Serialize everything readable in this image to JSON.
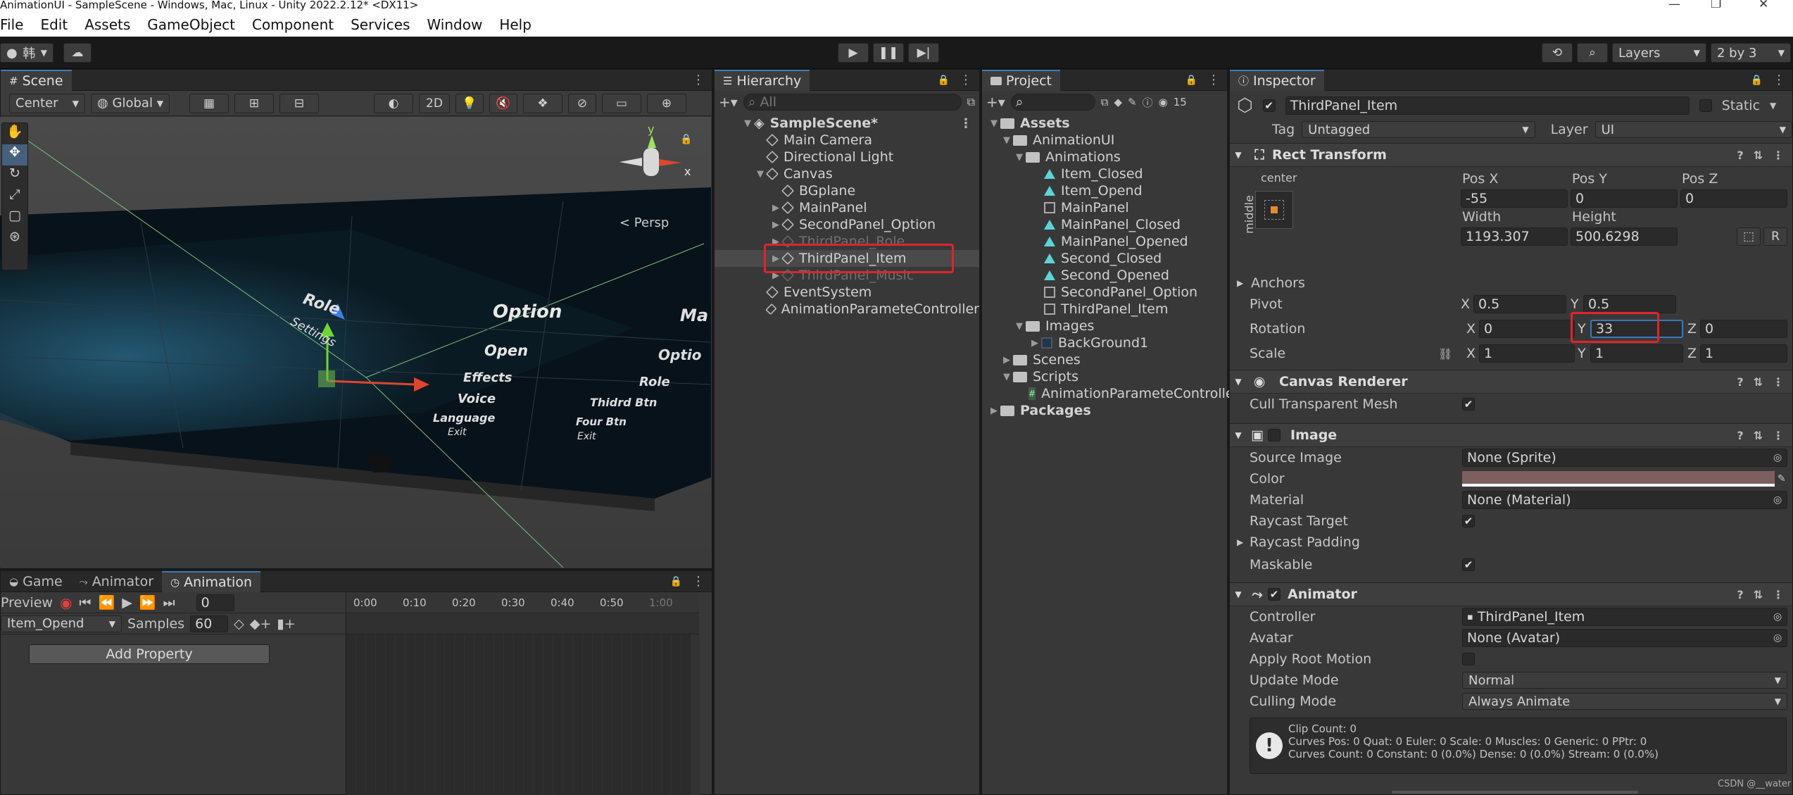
{
  "window": {
    "title": "AnimationUI - SampleScene - Windows, Mac, Linux - Unity 2022.2.12* <DX11>"
  },
  "menu": [
    "File",
    "Edit",
    "Assets",
    "GameObject",
    "Component",
    "Services",
    "Window",
    "Help"
  ],
  "toolbar": {
    "account": "韩",
    "layers": "Layers",
    "layout": "2 by 3"
  },
  "scene": {
    "tab": "Scene",
    "pivot": "Center",
    "space": "Global",
    "mode2d": "2D",
    "persp": "< Persp",
    "gizmo_y": "y",
    "gizmo_x": "x",
    "labels": [
      "Role",
      "Option",
      "Ma",
      "Settings",
      "Open",
      "Optio",
      "Effects",
      "Role",
      "Voice",
      "Thidrd Btn",
      "Language",
      "Four Btn",
      "Exit",
      "Exit"
    ]
  },
  "hierarchy": {
    "tab": "Hierarchy",
    "search_placeholder": "All",
    "items": [
      {
        "label": "SampleScene*"
      },
      {
        "label": "Main Camera"
      },
      {
        "label": "Directional Light"
      },
      {
        "label": "Canvas"
      },
      {
        "label": "BGplane"
      },
      {
        "label": "MainPanel"
      },
      {
        "label": "SecondPanel_Option"
      },
      {
        "label": "ThirdPanel_Role"
      },
      {
        "label": "ThirdPanel_Item"
      },
      {
        "label": "ThirdPanel_Music"
      },
      {
        "label": "EventSystem"
      },
      {
        "label": "AnimationParameteController"
      }
    ]
  },
  "project": {
    "tab": "Project",
    "count_badge": "15",
    "items": [
      {
        "label": "Assets"
      },
      {
        "label": "AnimationUI"
      },
      {
        "label": "Animations"
      },
      {
        "label": "Item_Closed"
      },
      {
        "label": "Item_Opend"
      },
      {
        "label": "MainPanel"
      },
      {
        "label": "MainPanel_Closed"
      },
      {
        "label": "MainPanel_Opened"
      },
      {
        "label": "Second_Closed"
      },
      {
        "label": "Second_Opened"
      },
      {
        "label": "SecondPanel_Option"
      },
      {
        "label": "ThirdPanel_Item"
      },
      {
        "label": "Images"
      },
      {
        "label": "BackGround1"
      },
      {
        "label": "Scenes"
      },
      {
        "label": "Scripts"
      },
      {
        "label": "AnimationParameteController"
      },
      {
        "label": "Packages"
      }
    ]
  },
  "inspector": {
    "tab": "Inspector",
    "object_name": "ThirdPanel_Item",
    "static_label": "Static",
    "tag_label": "Tag",
    "tag_value": "Untagged",
    "layer_label": "Layer",
    "layer_value": "UI",
    "rect_transform": {
      "title": "Rect Transform",
      "anchor_h": "center",
      "anchor_v": "middle",
      "pos_x_label": "Pos X",
      "pos_y_label": "Pos Y",
      "pos_z_label": "Pos Z",
      "pos_x": "-55",
      "pos_y": "0",
      "pos_z": "0",
      "width_label": "Width",
      "height_label": "Height",
      "width": "1193.307",
      "height": "500.6298",
      "anchors_label": "Anchors",
      "pivot_label": "Pivot",
      "pivot_x": "0.5",
      "pivot_y": "0.5",
      "rotation_label": "Rotation",
      "rot_x": "0",
      "rot_y": "33",
      "rot_z": "0",
      "scale_label": "Scale",
      "scale_x": "1",
      "scale_y": "1",
      "scale_z": "1",
      "axis_x": "X",
      "axis_y": "Y",
      "axis_z": "Z",
      "blueprint_btn": "R"
    },
    "canvas_renderer": {
      "title": "Canvas Renderer",
      "cull_label": "Cull Transparent Mesh"
    },
    "image": {
      "title": "Image",
      "source_label": "Source Image",
      "source_value": "None (Sprite)",
      "color_label": "Color",
      "color_value": "#7d5f5f",
      "material_label": "Material",
      "material_value": "None (Material)",
      "raycast_label": "Raycast Target",
      "raycast_padding_label": "Raycast Padding",
      "maskable_label": "Maskable"
    },
    "animator": {
      "title": "Animator",
      "controller_label": "Controller",
      "controller_value": "ThirdPanel_Item",
      "avatar_label": "Avatar",
      "avatar_value": "None (Avatar)",
      "root_motion_label": "Apply Root Motion",
      "update_label": "Update Mode",
      "update_value": "Normal",
      "culling_label": "Culling Mode",
      "culling_value": "Always Animate",
      "info_line1": "Clip Count: 0",
      "info_line2": "Curves Pos: 0 Quat: 0 Euler: 0 Scale: 0 Muscles: 0 Generic: 0 PPtr: 0",
      "info_line3": "Curves Count: 0 Constant: 0 (0.0%) Dense: 0 (0.0%) Stream: 0 (0.0%)"
    }
  },
  "animation": {
    "tabs": [
      "Game",
      "Animator",
      "Animation"
    ],
    "preview_label": "Preview",
    "frame_value": "0",
    "clip": "Item_Opend",
    "samples_label": "Samples",
    "samples_value": "60",
    "add_property": "Add Property",
    "ruler": [
      "0:00",
      "0:10",
      "0:20",
      "0:30",
      "0:40",
      "0:50",
      "1:00"
    ]
  },
  "watermark": "CSDN @__water"
}
